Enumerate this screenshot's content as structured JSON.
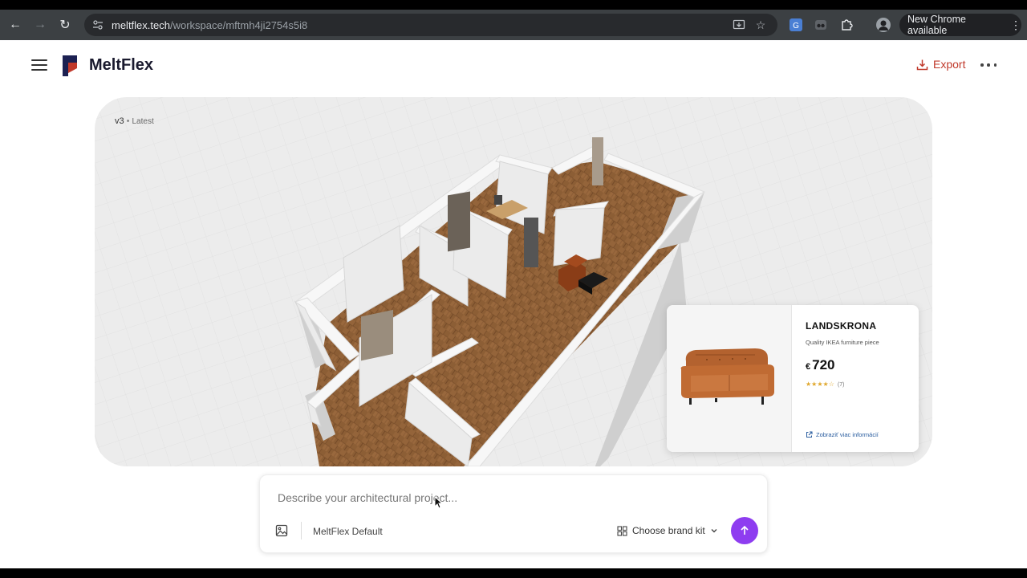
{
  "browser": {
    "url_host": "meltflex.tech",
    "url_path": "/workspace/mftmh4ji2754s5i8",
    "new_chrome_label": "New Chrome available"
  },
  "app": {
    "brand": "MeltFlex",
    "export_label": "Export",
    "accent_color": "#c0392b"
  },
  "viewport": {
    "version": "v3",
    "version_status": "Latest"
  },
  "product": {
    "name": "LANDSKRONA",
    "description": "Quality IKEA furniture piece",
    "currency": "€",
    "price": "720",
    "rating": 4,
    "rating_max": 5,
    "reviews": "(7)",
    "link_label": "Zobraziť viac informácií"
  },
  "prompt": {
    "placeholder": "Describe your architectural project...",
    "style_label": "MeltFlex Default",
    "brand_kit_label": "Choose brand kit",
    "send_color": "#8e3df0"
  }
}
